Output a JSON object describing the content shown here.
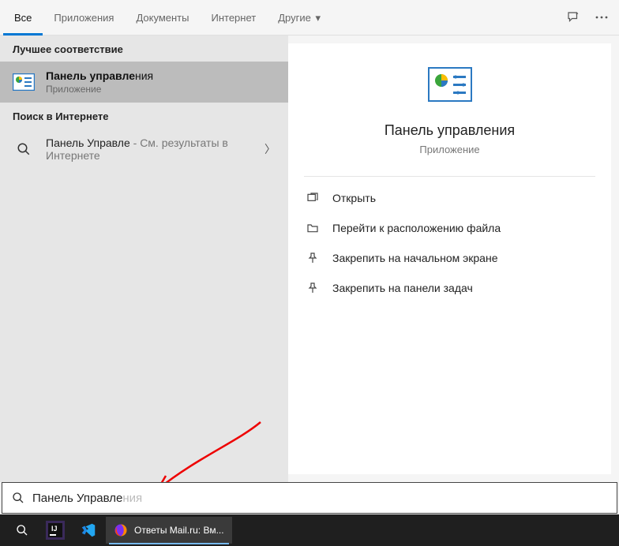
{
  "tabs": {
    "all": "Все",
    "apps": "Приложения",
    "docs": "Документы",
    "web": "Интернет",
    "other": "Другие"
  },
  "left": {
    "best_match_header": "Лучшее соответствие",
    "best_match": {
      "title_match": "Панель управле",
      "title_rest": "ния",
      "subtitle": "Приложение"
    },
    "web_header": "Поиск в Интернете",
    "web_item": {
      "title_match": "Панель Управле",
      "title_rest": " - См. результаты в Интернете"
    }
  },
  "detail": {
    "title": "Панель управления",
    "subtitle": "Приложение",
    "actions": {
      "open": "Открыть",
      "open_location": "Перейти к расположению файла",
      "pin_start": "Закрепить на начальном экране",
      "pin_taskbar": "Закрепить на панели задач"
    }
  },
  "search": {
    "typed": "Панель Управле",
    "suggestion": "ния"
  },
  "taskbar": {
    "browser_title": "Ответы Mail.ru: Вм..."
  }
}
